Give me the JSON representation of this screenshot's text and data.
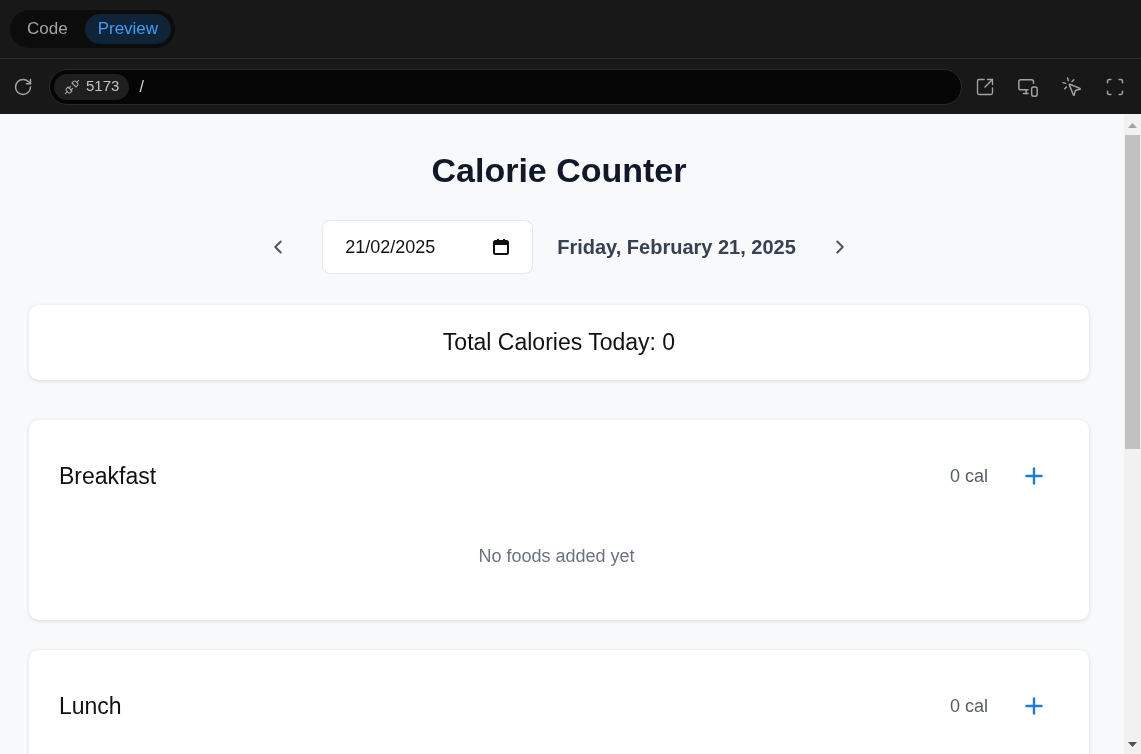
{
  "toolbar": {
    "tabs": [
      {
        "label": "Code",
        "selected": false
      },
      {
        "label": "Preview",
        "selected": true
      }
    ]
  },
  "address_bar": {
    "port": "5173",
    "path": "/"
  },
  "app": {
    "title": "Calorie Counter",
    "date_input": {
      "value": "21/02/2025"
    },
    "date_label": "Friday, February 21, 2025",
    "total": "Total Calories Today: 0",
    "meals": [
      {
        "name": "Breakfast",
        "calories": "0 cal",
        "empty_message": "No foods added yet"
      },
      {
        "name": "Lunch",
        "calories": "0 cal"
      }
    ]
  }
}
